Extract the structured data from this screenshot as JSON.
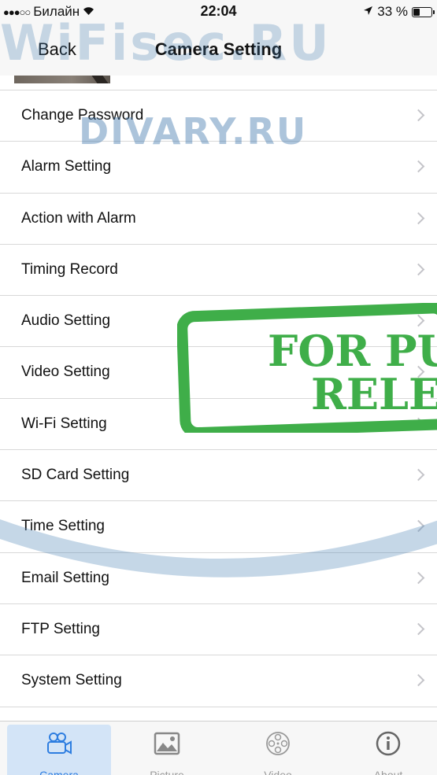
{
  "status_bar": {
    "carrier": "Билайн",
    "time": "22:04",
    "battery": "33 %",
    "battery_level": 0.33
  },
  "nav": {
    "back_label": "Back",
    "title": "Camera Setting"
  },
  "settings": {
    "items": [
      {
        "label": "Change Password"
      },
      {
        "label": "Alarm Setting"
      },
      {
        "label": "Action with Alarm"
      },
      {
        "label": "Timing Record"
      },
      {
        "label": "Audio Setting"
      },
      {
        "label": "Video Setting"
      },
      {
        "label": "Wi-Fi Setting"
      },
      {
        "label": "SD Card Setting"
      },
      {
        "label": "Time Setting"
      },
      {
        "label": "Email Setting"
      },
      {
        "label": "FTP Setting"
      },
      {
        "label": "System Setting"
      }
    ]
  },
  "tabs": {
    "items": [
      {
        "label": "Camera",
        "icon": "video-camera-icon",
        "selected": true
      },
      {
        "label": "Picture",
        "icon": "picture-icon",
        "selected": false
      },
      {
        "label": "Video",
        "icon": "film-reel-icon",
        "selected": false
      },
      {
        "label": "About",
        "icon": "info-icon",
        "selected": false
      }
    ]
  },
  "watermarks": {
    "site1": "WiFisec.RU",
    "site2": "DIVARY.RU",
    "stamp_line1": "FOR PU",
    "stamp_line2": "RELE"
  },
  "colors": {
    "accent": "#2d7de0",
    "tab_selected_bg": "#d3e4f7",
    "stamp_green": "#3fae49"
  }
}
